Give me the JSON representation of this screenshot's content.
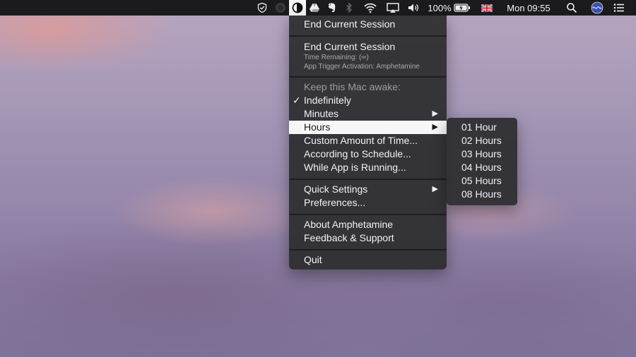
{
  "menubar": {
    "battery_percent": "100%",
    "datetime": "Mon 09:55",
    "icons": [
      "checklist-icon",
      "disc-icon",
      "amphetamine-icon",
      "drive-icon",
      "evernote-icon",
      "bluetooth-icon",
      "wifi-icon",
      "airplay-icon",
      "volume-icon",
      "battery-icon",
      "uk-flag-icon",
      "search-icon",
      "siri-icon",
      "list-icon"
    ]
  },
  "menu": {
    "end_session_top": "End Current Session",
    "end_session": "End Current Session",
    "time_remaining": "Time Remaining: (∞)",
    "trigger": "App Trigger Activation: Amphetamine",
    "keep_awake_header": "Keep this Mac awake:",
    "indefinitely": "Indefinitely",
    "checkmark": "✓",
    "minutes": "Minutes",
    "hours": "Hours",
    "custom": "Custom Amount of Time...",
    "schedule": "According to Schedule...",
    "while_app": "While App is Running...",
    "quick_settings": "Quick Settings",
    "preferences": "Preferences...",
    "about": "About Amphetamine",
    "feedback": "Feedback & Support",
    "quit": "Quit",
    "arrow": "▶"
  },
  "submenu": {
    "items": [
      "01 Hour",
      "02 Hours",
      "03 Hours",
      "04 Hours",
      "05 Hours",
      "08 Hours"
    ]
  }
}
